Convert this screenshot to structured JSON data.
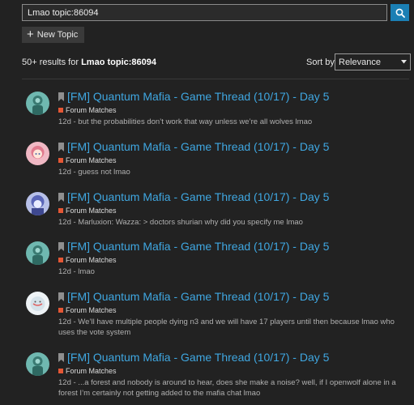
{
  "search": {
    "value": "Lmao topic:86094"
  },
  "new_topic_label": "New Topic",
  "results_count": "50+ results for",
  "results_query": "Lmao topic:86094",
  "sort": {
    "label": "Sort by",
    "selected": "Relevance"
  },
  "colors": {
    "link": "#3fa7e1",
    "category": "#e45735",
    "button": "#1b7fb4"
  },
  "results": [
    {
      "title": "[FM] Quantum Mafia - Game Thread (10/17) - Day 5",
      "category": "Forum Matches",
      "date": "12d",
      "blurb": " - but the probabilities don’t work that way unless we’re all wolves lmao"
    },
    {
      "title": "[FM] Quantum Mafia - Game Thread (10/17) - Day 5",
      "category": "Forum Matches",
      "date": "12d",
      "blurb": " - guess not lmao"
    },
    {
      "title": "[FM] Quantum Mafia - Game Thread (10/17) - Day 5",
      "category": "Forum Matches",
      "date": "12d",
      "blurb": " - Marluxion: Wazza: > doctors shurian why did you specify me lmao"
    },
    {
      "title": "[FM] Quantum Mafia - Game Thread (10/17) - Day 5",
      "category": "Forum Matches",
      "date": "12d",
      "blurb": " - lmao"
    },
    {
      "title": "[FM] Quantum Mafia - Game Thread (10/17) - Day 5",
      "category": "Forum Matches",
      "date": "12d",
      "blurb": " - We’ll have multiple people dying n3 and we will have 17 players until then because lmao who uses the vote system"
    },
    {
      "title": "[FM] Quantum Mafia - Game Thread (10/17) - Day 5",
      "category": "Forum Matches",
      "date": "12d",
      "blurb": " - ...a forest and nobody is around to hear, does she make a noise? well, if I openwolf alone in a forest I’m certainly not getting added to the mafia chat lmao"
    }
  ]
}
